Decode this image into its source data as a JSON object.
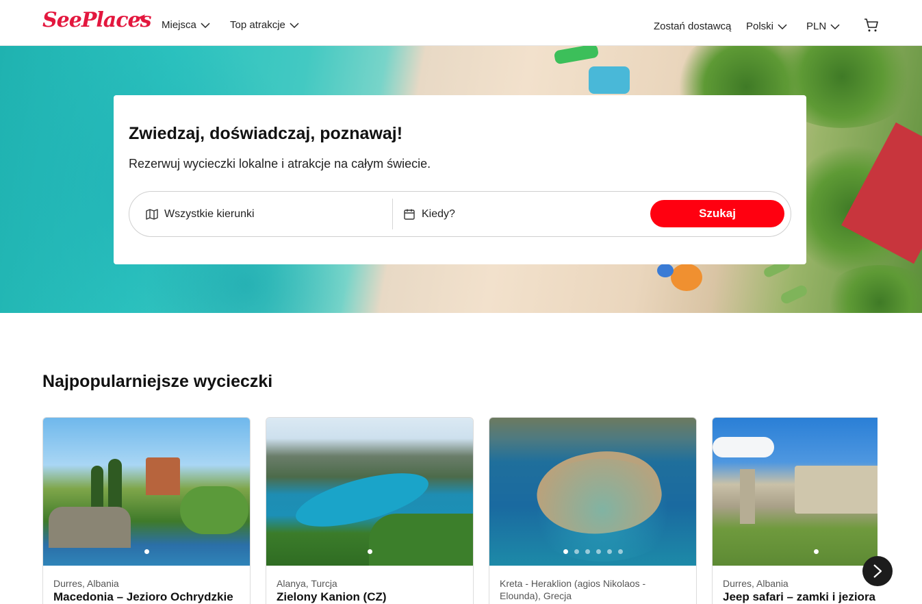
{
  "header": {
    "logo": "SeePlaces",
    "nav": [
      {
        "label": "Miejsca"
      },
      {
        "label": "Top atrakcje"
      }
    ],
    "supplier_link": "Zostań dostawcą",
    "language": "Polski",
    "currency": "PLN"
  },
  "hero": {
    "title": "Zwiedzaj, doświadczaj, poznawaj!",
    "subtitle": "Rezerwuj wycieczki lokalne i atrakcje na całym świecie.",
    "destination_placeholder": "Wszystkie kierunki",
    "date_placeholder": "Kiedy?",
    "search_button": "Szukaj"
  },
  "section": {
    "title": "Najpopularniejsze wycieczki"
  },
  "cards": [
    {
      "location": "Durres, Albania",
      "title": "Macedonia – Jezioro Ochrydzkie",
      "dots": 1
    },
    {
      "location": "Alanya, Turcja",
      "title": "Zielony Kanion (CZ)",
      "dots": 1
    },
    {
      "location": "Kreta - Heraklion (agios Nikolaos - Elounda), Grecja",
      "title": "",
      "dots": 6
    },
    {
      "location": "Durres, Albania",
      "title": "Jeep safari – zamki i jeziora",
      "dots": 1
    }
  ],
  "colors": {
    "brand": "#e3173e",
    "search_button": "#ff0010"
  }
}
